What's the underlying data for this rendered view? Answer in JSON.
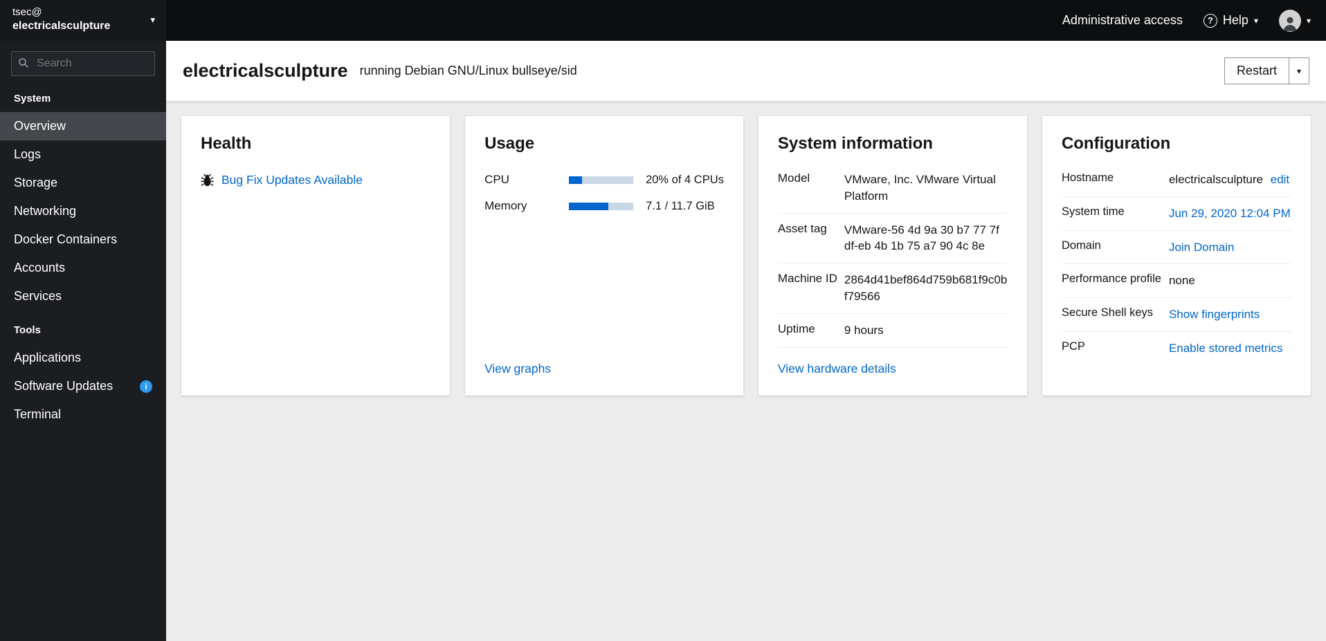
{
  "colors": {
    "accent_blue": "#0066cc",
    "sidebar_bg": "#1b1d21",
    "topbar_bg": "#0c0e10",
    "content_bg": "#ececec",
    "progress_fill": "#0066cc",
    "progress_track": "#c9d6e4",
    "selected_nav_bg": "#44484d"
  },
  "icons": {
    "chevron_down": "▾",
    "help": "?",
    "info": "i"
  },
  "sidebar": {
    "user": "tsec@",
    "host": "electricalsculpture",
    "search_placeholder": "Search",
    "sections": [
      {
        "title": "System",
        "items": [
          "Overview",
          "Logs",
          "Storage",
          "Networking",
          "Docker Containers",
          "Accounts",
          "Services"
        ]
      },
      {
        "title": "Tools",
        "items": [
          "Applications",
          "Software Updates",
          "Terminal"
        ]
      }
    ]
  },
  "topbar": {
    "admin_access_label": "Administrative access",
    "help_label": "Help"
  },
  "page_header": {
    "hostname": "electricalsculpture",
    "os_text": "running Debian GNU/Linux bullseye/sid",
    "restart_label": "Restart"
  },
  "cards": {
    "health": {
      "title": "Health",
      "updates_link": "Bug Fix Updates Available"
    },
    "usage": {
      "title": "Usage",
      "cpu_label": "CPU",
      "cpu_text": "20% of 4 CPUs",
      "cpu_bar_width": "20%",
      "memory_label": "Memory",
      "memory_text": "7.1 / 11.7 GiB",
      "memory_bar_width": "61%",
      "graphs_link": "View graphs"
    },
    "system_info": {
      "title": "System information",
      "rows": [
        {
          "label": "Model",
          "value": "VMware, Inc. VMware Virtual Platform"
        },
        {
          "label": "Asset tag",
          "value": "VMware-56 4d 9a 30 b7 77 7f df-eb 4b 1b 75 a7 90 4c 8e"
        },
        {
          "label": "Machine ID",
          "value": "2864d41bef864d759b681f9c0bf79566"
        },
        {
          "label": "Uptime",
          "value": "9 hours"
        }
      ],
      "hardware_link": "View hardware details"
    },
    "configuration": {
      "title": "Configuration",
      "hostname_label": "Hostname",
      "hostname_value": "electricalsculpture",
      "hostname_edit": "edit",
      "system_time_label": "System time",
      "system_time_value": "Jun 29, 2020 12:04 PM",
      "domain_label": "Domain",
      "domain_value": "Join Domain",
      "perf_label": "Performance profile",
      "perf_value": "none",
      "ssh_label": "Secure Shell keys",
      "ssh_value": "Show fingerprints",
      "pcp_label": "PCP",
      "pcp_value": "Enable stored metrics"
    }
  }
}
